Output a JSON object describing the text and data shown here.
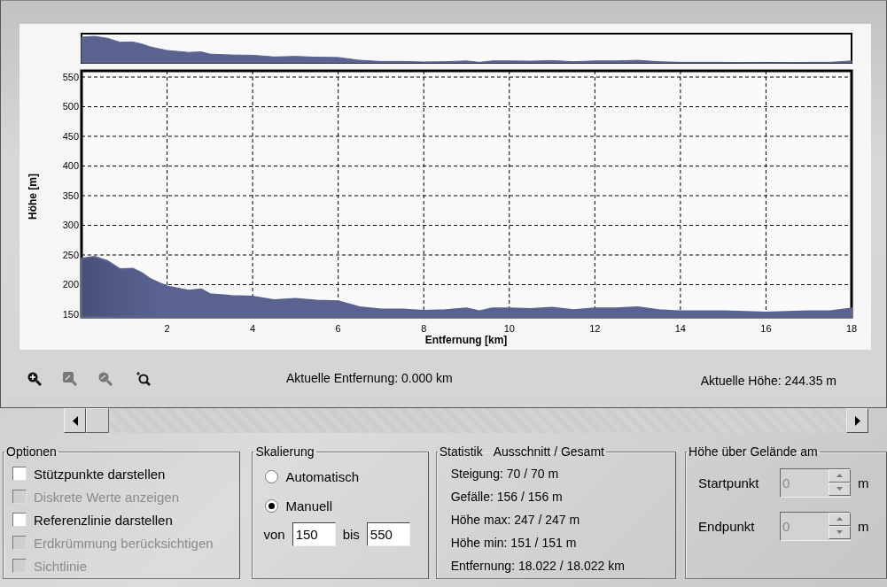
{
  "chart": {
    "chart_data": {
      "type": "area",
      "grid": true,
      "xlabel": "Entfernung [km]",
      "ylabel": "Höhe [m]",
      "xlim": [
        0,
        18
      ],
      "ylim": [
        145.5,
        550
      ],
      "xticks": [
        2,
        4,
        6,
        8,
        10,
        12,
        14,
        16,
        18
      ],
      "yticks": [
        150,
        200,
        250,
        300,
        350,
        400,
        450,
        500,
        550
      ],
      "x": [
        0,
        0.3,
        0.6,
        0.9,
        1.2,
        1.4,
        1.6,
        1.8,
        2,
        2.5,
        2.8,
        3,
        3.5,
        4,
        4.5,
        5,
        5.5,
        6,
        6.5,
        7,
        7.5,
        8,
        8.5,
        9,
        9.3,
        9.6,
        10,
        10.5,
        11,
        11.5,
        12,
        12.5,
        13,
        13.5,
        14,
        15,
        16,
        17,
        17.5,
        18
      ],
      "series": [
        {
          "color": "#5a6290",
          "values": [
            244,
            247,
            240,
            226,
            227,
            220,
            210,
            203,
            197,
            190,
            192,
            184,
            181,
            180,
            174,
            176,
            173,
            172,
            162,
            158,
            158,
            156,
            157,
            160,
            155,
            160,
            160,
            159,
            161,
            157,
            160,
            160,
            162,
            157,
            155,
            155,
            153,
            155,
            155,
            160
          ]
        }
      ]
    }
  },
  "toolbar": [
    {
      "kind": "zoom_in",
      "disabled": false
    },
    {
      "kind": "zoom_box",
      "disabled": true
    },
    {
      "kind": "zoom_out",
      "disabled": true
    },
    {
      "kind": "zoom_reset",
      "disabled": false
    }
  ],
  "current_distance": "Aktuelle Entfernung: 0.000 km",
  "current_height": "Aktuelle Höhe: 244.35 m",
  "options": {
    "title": "Optionen",
    "items": [
      {
        "label": "Stützpunkte darstellen",
        "checked": false,
        "disabled": false
      },
      {
        "label": "Diskrete Werte anzeigen",
        "checked": false,
        "disabled": true
      },
      {
        "label": "Referenzlinie darstellen",
        "checked": false,
        "disabled": false
      },
      {
        "label": "Erdkrümmung berücksichtigen",
        "checked": false,
        "disabled": true
      },
      {
        "label": "Sichtlinie",
        "checked": false,
        "disabled": true
      }
    ]
  },
  "scaling": {
    "title": "Skalierung",
    "modes": [
      {
        "label": "Automatisch",
        "selected": false
      },
      {
        "label": "Manuell",
        "selected": true
      }
    ],
    "from_label": "von",
    "from": "150",
    "to_label": "bis",
    "to": "550"
  },
  "statistics": {
    "title": "Statistik",
    "subtitle": "Ausschnitt / Gesamt",
    "lines": [
      "Steigung: 70 / 70 m",
      "Gefälle: 156 / 156 m",
      "Höhe max: 247 / 247 m",
      "Höhe min: 151 / 151 m",
      "Entfernung: 18.022 / 18.022 km"
    ]
  },
  "height_above_ground": {
    "title": "Höhe über Gelände am",
    "fields": [
      {
        "label": "Startpunkt",
        "value": "0",
        "unit": "m",
        "disabled": true
      },
      {
        "label": "Endpunkt",
        "value": "0",
        "unit": "m",
        "disabled": true
      }
    ]
  }
}
